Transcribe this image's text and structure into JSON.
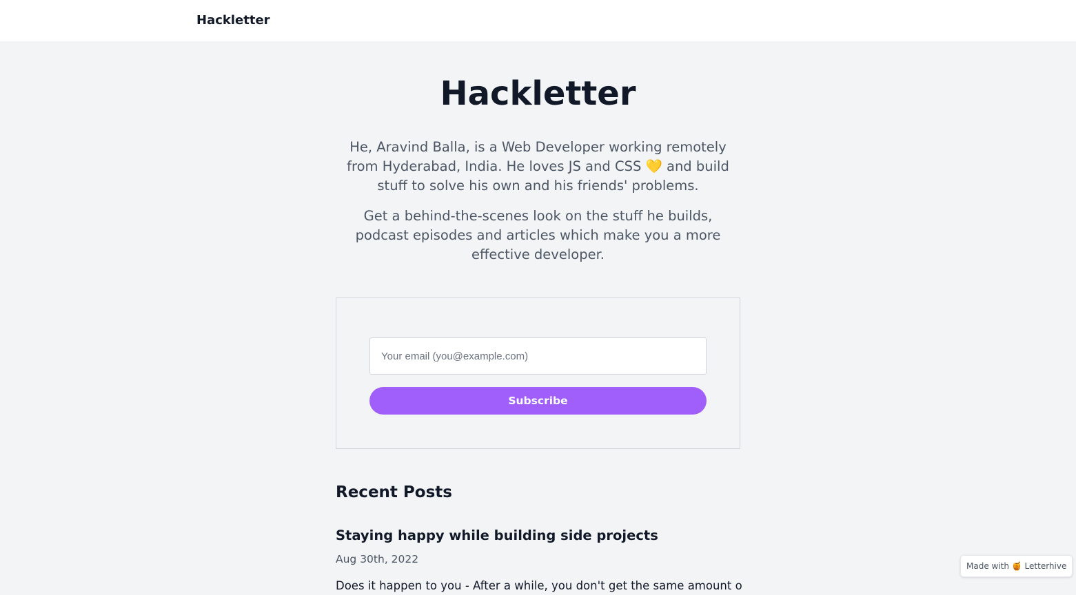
{
  "header": {
    "brand": "Hackletter"
  },
  "hero": {
    "title": "Hackletter",
    "intro_1": "He, Aravind Balla, is a Web Developer working remotely from Hyderabad, India. He loves JS and CSS 💛 and build stuff to solve his own and his friends' problems.",
    "intro_2": "Get a behind-the-scenes look on the stuff he builds, podcast episodes and articles which make you a more effective developer."
  },
  "subscribe": {
    "email_placeholder": "Your email (you@example.com)",
    "email_value": "",
    "button_label": "Subscribe"
  },
  "recent_posts": {
    "heading": "Recent Posts",
    "posts": [
      {
        "title": "Staying happy while building side projects",
        "date": "Aug 30th, 2022",
        "excerpt": "Does it happen to you - After a while, you don't get the same amount of"
      }
    ]
  },
  "footer_badge": {
    "text": "Made with 🍯 Letterhive"
  },
  "colors": {
    "background": "#f3f4f6",
    "accent": "#a05ffb",
    "text_primary": "#111827",
    "text_secondary": "#4b5563"
  }
}
